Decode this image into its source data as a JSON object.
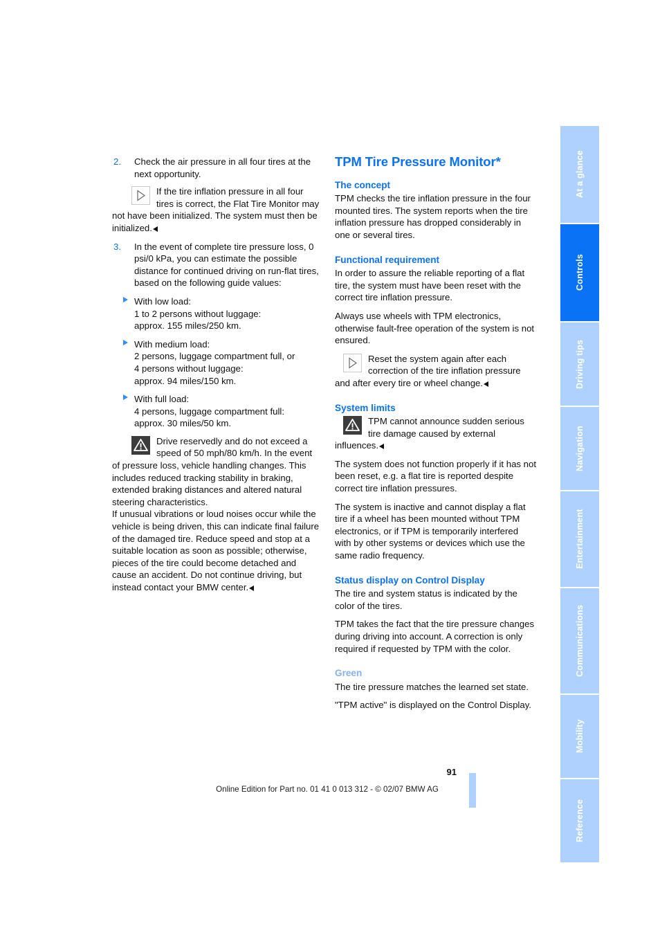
{
  "document": {
    "page_number": "91",
    "footer": "Online Edition for Part no. 01 41 0 013 312 - © 02/07 BMW AG"
  },
  "side_tabs": [
    {
      "label": "At a glance",
      "active": false
    },
    {
      "label": "Controls",
      "active": true
    },
    {
      "label": "Driving tips",
      "active": false
    },
    {
      "label": "Navigation",
      "active": false
    },
    {
      "label": "Entertainment",
      "active": false
    },
    {
      "label": "Communications",
      "active": false
    },
    {
      "label": "Mobility",
      "active": false
    },
    {
      "label": "Reference",
      "active": false
    }
  ],
  "left_column": {
    "item2": {
      "marker": "2.",
      "text": "Check the air pressure in all four tires at the next opportunity."
    },
    "note1": {
      "icon": "note-triangle-icon",
      "text": "If the tire inflation pressure in all four tires is correct, the Flat Tire Monitor may not have been initialized. The system must then be initialized."
    },
    "item3": {
      "marker": "3.",
      "text": "In the event of complete tire pressure loss, 0 psi/0 kPa, you can estimate the possible distance for continued driving on run-flat tires, based on the following guide values:"
    },
    "load_cases": [
      {
        "title": "With low load:",
        "lines": [
          "1 to 2 persons without luggage:",
          "approx. 155 miles/250 km."
        ]
      },
      {
        "title": "With medium load:",
        "lines": [
          "2 persons, luggage compartment full, or",
          "4 persons without luggage:",
          "approx. 94 miles/150 km."
        ]
      },
      {
        "title": "With full load:",
        "lines": [
          "4 persons, luggage compartment full:",
          "approx. 30 miles/50 km."
        ]
      }
    ],
    "warning": {
      "icon": "warning-triangle-icon",
      "paragraph1": "Drive reservedly and do not exceed a speed of 50 mph/80 km/h. In the event of pressure loss, vehicle handling changes. This includes reduced tracking stability in braking, extended braking distances and altered natural steering characteristics.",
      "paragraph2": "If unusual vibrations or loud noises occur while the vehicle is being driven, this can indicate final failure of the damaged tire. Reduce speed and stop at a suitable location as soon as possible; otherwise, pieces of the tire could become detached and cause an accident. Do not continue driving, but instead contact your BMW center."
    }
  },
  "right_column": {
    "title": "TPM Tire Pressure Monitor*",
    "sections": [
      {
        "heading": "The concept",
        "paragraphs": [
          "TPM checks the tire inflation pressure in the four mounted tires. The system reports when the tire inflation pressure has dropped considerably in one or several tires."
        ]
      },
      {
        "heading": "Functional requirement",
        "paragraphs": [
          "In order to assure the reliable reporting of a flat tire, the system must have been reset with the correct tire inflation pressure.",
          "Always use wheels with TPM electronics, otherwise fault-free operation of the system is not ensured."
        ],
        "note": {
          "icon": "note-triangle-icon",
          "text": "Reset the system again after each correction of the tire inflation pressure and after every tire or wheel change."
        }
      },
      {
        "heading": "System limits",
        "warning": {
          "icon": "warning-triangle-icon",
          "text": "TPM cannot announce sudden serious tire damage caused by external influences."
        },
        "paragraphs": [
          "The system does not function properly if it has not been reset, e.g. a flat tire is reported despite correct tire inflation pressures.",
          "The system is inactive and cannot display a flat tire if a wheel has been mounted without TPM electronics, or if TPM is temporarily interfered with by other systems or devices which use the same radio frequency."
        ]
      },
      {
        "heading": "Status display on Control Display",
        "paragraphs": [
          "The tire and system status is indicated by the color of the tires.",
          "TPM takes the fact that the tire pressure changes during driving into account. A correction is only required if requested by TPM with the color."
        ]
      },
      {
        "heading": "Green",
        "heading_style": "light",
        "paragraphs": [
          "The tire pressure matches the learned set state.",
          "\"TPM active\" is displayed on the Control Display."
        ]
      }
    ]
  },
  "colors": {
    "accent_blue": "#0a72f5",
    "light_blue": "#aed2fd",
    "heading_light_blue": "#84b1f3",
    "text": "#111111"
  }
}
